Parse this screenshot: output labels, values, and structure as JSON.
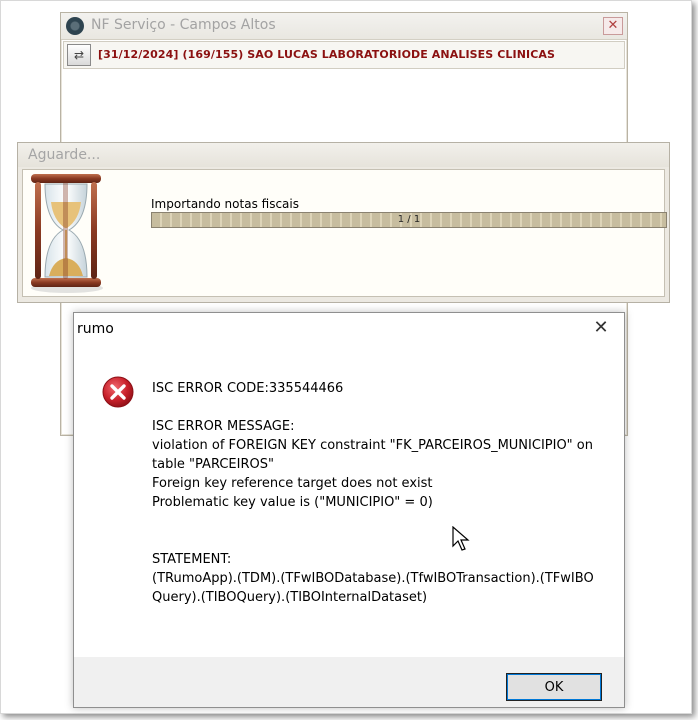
{
  "nf_window": {
    "title": "NF Serviço - Campos Altos",
    "close_glyph": "✕",
    "swap_glyph": "⇄",
    "info_text": "[31/12/2024] (169/155) SAO LUCAS LABORATORIODE ANALISES CLINICAS"
  },
  "wait_dialog": {
    "title": "Aguarde...",
    "status_label": "Importando notas fiscais",
    "progress_text": "1 / 1",
    "progress_fraction": 1.0
  },
  "error_dialog": {
    "title": "rumo",
    "close_glyph": "✕",
    "message": "ISC ERROR CODE:335544466\n\nISC ERROR MESSAGE:\nviolation of FOREIGN KEY constraint \"FK_PARCEIROS_MUNICIPIO\" on table \"PARCEIROS\"\nForeign key reference target does not exist\nProblematic key value is (\"MUNICIPIO\" = 0)\n\n\nSTATEMENT:\n(TRumoApp).(TDM).(TFwIBODatabase).(TfwIBOTransaction).(TFwIBOQuery).(TIBOQuery).(TIBOInternalDataset)",
    "ok_label": "OK",
    "icon": "error-icon"
  },
  "colors": {
    "info_text": "#8b1010",
    "error_icon": "#c8202a",
    "focus_accent": "#0078d7"
  }
}
